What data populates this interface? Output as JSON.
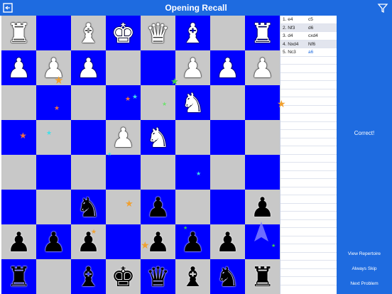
{
  "header": {
    "title": "Opening Recall",
    "back_icon": "back-square-icon",
    "filter_icon": "filter-funnel-icon"
  },
  "colors": {
    "accent": "#1e6be0",
    "board_dark": "#0000ff",
    "board_light": "#c8c8c8"
  },
  "board": {
    "orientation": "white-top",
    "ranks": [
      [
        "wR",
        "",
        "wB",
        "wK",
        "wQ",
        "wB",
        "",
        "wR"
      ],
      [
        "wP",
        "wP",
        "wP",
        "",
        "",
        "wP",
        "wP",
        "wP"
      ],
      [
        "",
        "",
        "",
        "",
        "",
        "wN",
        "",
        ""
      ],
      [
        "",
        "",
        "",
        "wP",
        "wN",
        "",
        "",
        ""
      ],
      [
        "",
        "",
        "",
        "",
        "",
        "",
        "",
        ""
      ],
      [
        "",
        "",
        "bN",
        "",
        "bP",
        "",
        "",
        "bP"
      ],
      [
        "bP",
        "bP",
        "bP",
        "",
        "bP",
        "bP",
        "bP",
        ""
      ],
      [
        "bR",
        "",
        "bB",
        "bK",
        "bQ",
        "bB",
        "bN",
        "bR"
      ]
    ]
  },
  "moves": [
    {
      "num": "1.",
      "white": "e4",
      "black": "c5"
    },
    {
      "num": "2.",
      "white": "Nf3",
      "black": "d6"
    },
    {
      "num": "3.",
      "white": "d4",
      "black": "cxd4"
    },
    {
      "num": "4.",
      "white": "Nxd4",
      "black": "Nf6"
    },
    {
      "num": "5.",
      "white": "Nc3",
      "black": "a6"
    }
  ],
  "status": {
    "message": "Correct!"
  },
  "buttons": {
    "view_repertoire": "View Repertoire",
    "always_skip": "Always Skip",
    "next_problem": "Next Problem"
  }
}
